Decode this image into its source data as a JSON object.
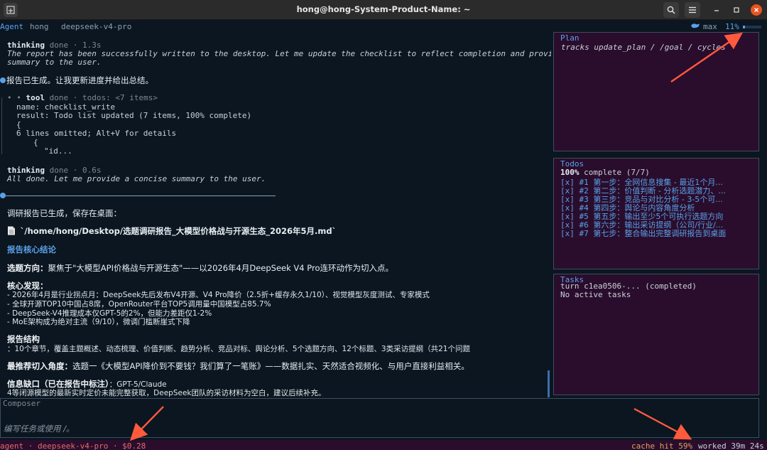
{
  "window": {
    "title": "hong@hong-System-Product-Name: ~"
  },
  "header": {
    "agent": "Agent",
    "user": "hong",
    "model": "deepseek-v4-pro",
    "mode_icon": "whale-icon",
    "mode": "max",
    "context_pct": "11%",
    "context_fill": 0.11
  },
  "transcript": {
    "thinking1": {
      "label": "thinking",
      "meta": "done · 1.3s",
      "text1": "The report has been successfully written to the desktop. Let me update the checklist to reflect completion and provide a",
      "text2": "summary to the user."
    },
    "msg1": "报告已生成。让我更新进度并给出总结。",
    "tool": {
      "bullets": "• •",
      "label": "tool",
      "meta": "done · todos: <7 items>",
      "name": "name: checklist_write",
      "result": "result: Todo list updated (7 items, 100% complete)",
      "brace": "{",
      "omitted": "6 lines omitted; Alt+V for details",
      "brace2": "{",
      "id": "\"id..."
    },
    "thinking2": {
      "label": "thinking",
      "meta": "done · 0.6s",
      "text": "All done. Let me provide a concise summary to the user."
    },
    "summary": {
      "intro": "调研报告已生成，保存在桌面：",
      "file_icon": "document-icon",
      "path": "`/home/hong/Desktop/选题调研报告_大模型价格战与开源生态_2026年5月.md`",
      "h_core": "报告核心结论",
      "direction_label": "选题方向：",
      "direction_text": "聚焦于\"大模型API价格战与开源生态\"——以2026年4月DeepSeek V4 Pro连环动作为切入点。",
      "findings_label": "核心发现：",
      "findings": [
        "- 2026年4月是行业拐点月：DeepSeek先后发布V4开源、V4 Pro降价（2.5折+缓存永久1/10）、视觉模型灰度测试、专家模式",
        "- 全球开源TOP10中国占8席，OpenRouter平台TOP5调用量中国模型占85.7%",
        "- DeepSeek-V4推理成本仅GPT-5的2%，但能力差距仅1-2%",
        "- MoE架构成为绝对主流（9/10），微调门槛断崖式下降"
      ],
      "structure_label": "报告结构",
      "structure_text": "：10个章节，覆盖主题概述、动态梳理、价值判断、趋势分析、竞品对标、舆论分析、5个选题方向、12个标题、3类采访提纲（共21个问题",
      "best_label": "最推荐切入角度：",
      "best_text": "选题一《大模型API降价到不要钱？我们算了一笔账》——数据扎实、天然适合视频化、与用户直接利益相关。",
      "gap_label": "信息缺口（已在报告中标注）",
      "gap_text": "：GPT-5/Claude",
      "gap_text2": "4等闭源模型的最新实时定价未能完整获取，DeepSeek团队的采访材料为空白，建议后续补充。"
    }
  },
  "plan": {
    "title": "Plan",
    "body": "tracks update_plan / /goal / cycles"
  },
  "todos": {
    "title": "Todos",
    "pct": "100%",
    "status": "complete (7/7)",
    "items": [
      {
        "box": "[x]",
        "num": "#1",
        "text": "第一步：全网信息搜集 - 最近1个月..."
      },
      {
        "box": "[x]",
        "num": "#2",
        "text": "第二步：价值判断 - 分析选题潜力、..."
      },
      {
        "box": "[x]",
        "num": "#3",
        "text": "第三步：竞品与对比分析 - 3-5个可..."
      },
      {
        "box": "[x]",
        "num": "#4",
        "text": "第四步：舆论与内容角度分析"
      },
      {
        "box": "[x]",
        "num": "#5",
        "text": "第五步：输出至少5个可执行选题方向"
      },
      {
        "box": "[x]",
        "num": "#6",
        "text": "第六步：输出采访提纲（公司/行业/..."
      },
      {
        "box": "[x]",
        "num": "#7",
        "text": "第七步：整合输出完整调研报告到桌面"
      }
    ]
  },
  "tasks": {
    "title": "Tasks",
    "line1": "turn c1ea0506-... (completed)",
    "line2": "No active tasks"
  },
  "composer": {
    "label": "Composer",
    "placeholder": "编写任务或使用 /。"
  },
  "status": {
    "left": "agent · deepseek-v4-pro · $0.28",
    "cache": "cache hit 59%",
    "worked": "worked 39m 24s"
  },
  "colors": {
    "accent": "#5aa0e8",
    "panel_bg": "#2a0d2c",
    "arrow": "#ff5a3c",
    "close": "#e95420"
  }
}
